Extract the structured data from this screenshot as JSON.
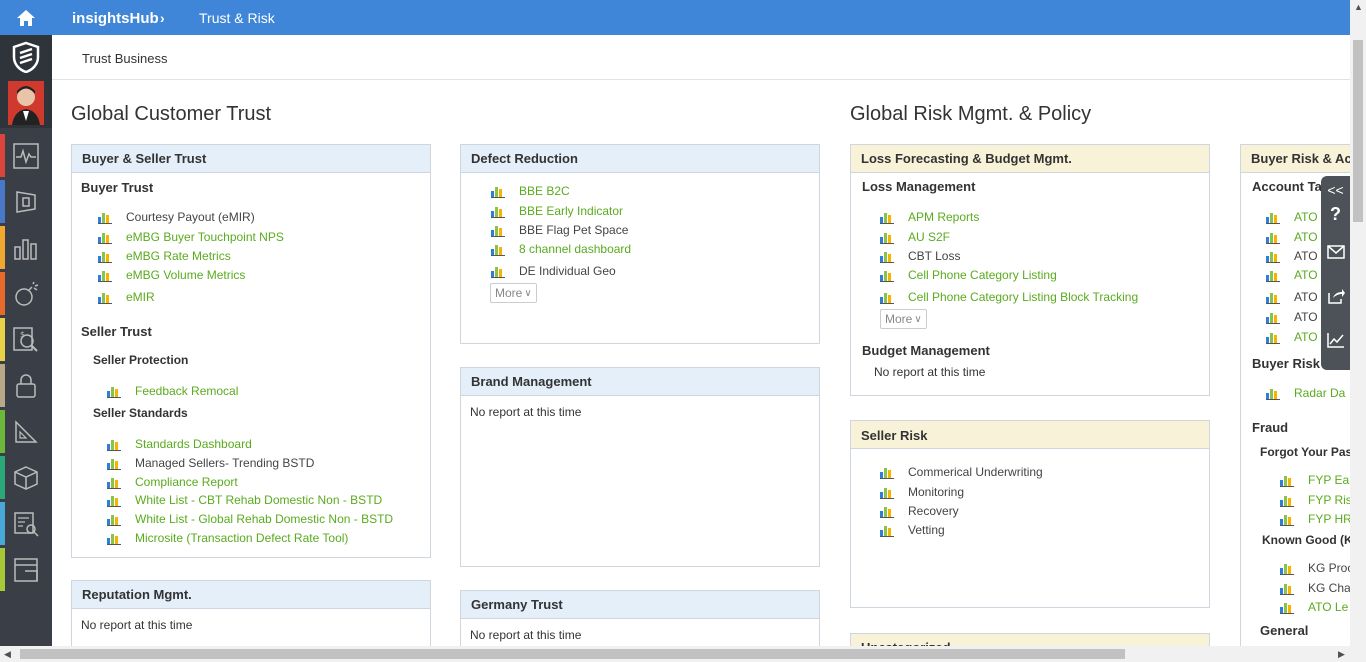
{
  "topbar": {
    "app": "insightsHub",
    "page": "Trust & Risk"
  },
  "subheader": {
    "tab": "Trust Business"
  },
  "sections": {
    "left": "Global Customer Trust",
    "right": "Global Risk Mgmt. & Policy"
  },
  "buyer_seller": {
    "title": "Buyer & Seller Trust",
    "buyer_trust": "Buyer Trust",
    "buyer_items": [
      {
        "label": "Courtesy Payout (eMIR)"
      },
      {
        "label": "eMBG Buyer Touchpoint NPS"
      },
      {
        "label": "eMBG Rate Metrics"
      },
      {
        "label": "eMBG Volume Metrics"
      },
      {
        "label": "eMIR"
      }
    ],
    "seller_trust": "Seller Trust",
    "seller_protection": "Seller Protection",
    "protection_items": [
      {
        "label": "Feedback Remocal"
      }
    ],
    "seller_standards": "Seller Standards",
    "standards_items": [
      {
        "label": "Standards Dashboard"
      },
      {
        "label": "Managed Sellers- Trending BSTD"
      },
      {
        "label": "Compliance Report"
      },
      {
        "label": "White  List - CBT Rehab Domestic Non - BSTD"
      },
      {
        "label": "White List - Global Rehab Domestic Non - BSTD"
      },
      {
        "label": "Microsite (Transaction Defect Rate Tool)"
      }
    ]
  },
  "reputation": {
    "title": "Reputation Mgmt.",
    "empty": "No report at this time"
  },
  "defect": {
    "title": "Defect Reduction",
    "items": [
      {
        "label": "BBE B2C"
      },
      {
        "label": "BBE Early Indicator"
      },
      {
        "label": "BBE Flag Pet Space"
      },
      {
        "label": "8 channel dashboard"
      },
      {
        "label": "DE Individual Geo"
      }
    ],
    "more": "More"
  },
  "brand": {
    "title": "Brand Management",
    "empty": "No report at this time"
  },
  "germany": {
    "title": "Germany Trust",
    "empty": "No report at this time"
  },
  "loss": {
    "title": "Loss Forecasting & Budget Mgmt.",
    "loss_mgmt": "Loss Management",
    "items": [
      {
        "label": "APM Reports"
      },
      {
        "label": "AU S2F"
      },
      {
        "label": "CBT Loss"
      },
      {
        "label": "Cell Phone Category Listing"
      },
      {
        "label": "Cell Phone Category Listing Block Tracking"
      }
    ],
    "more": "More",
    "budget": "Budget Management",
    "budget_empty": "No report at this time"
  },
  "seller_risk": {
    "title": "Seller Risk",
    "items": [
      {
        "label": "Commerical Underwriting"
      },
      {
        "label": "Monitoring"
      },
      {
        "label": "Recovery"
      },
      {
        "label": "Vetting"
      }
    ]
  },
  "uncategorized": {
    "title": "Uncategorized"
  },
  "buyer_risk": {
    "title": "Buyer Risk & Ac",
    "account": "Account Ta",
    "ato_items": [
      {
        "label": "ATO"
      },
      {
        "label": "ATO"
      },
      {
        "label": "ATO"
      },
      {
        "label": "ATO"
      },
      {
        "label": "ATO"
      },
      {
        "label": "ATO"
      },
      {
        "label": "ATO"
      }
    ],
    "buyer_risk_group": "Buyer Risk",
    "radar": "Radar Da",
    "fraud": "Fraud",
    "forgot": "Forgot Your Pas",
    "fyp_items": [
      {
        "label": "FYP Ea"
      },
      {
        "label": "FYP Ris"
      },
      {
        "label": "FYP HR"
      }
    ],
    "known_good": "Known Good (K",
    "kg_items": [
      {
        "label": "KG Proc"
      },
      {
        "label": "KG Cha"
      },
      {
        "label": "ATO Le"
      }
    ],
    "general": "General"
  },
  "floatbar": {
    "collapse": "<<",
    "help": "?"
  },
  "colors": {
    "topbar": "#3f86d8",
    "sidebar": "#3a3f47",
    "link": "#5aab1e"
  }
}
